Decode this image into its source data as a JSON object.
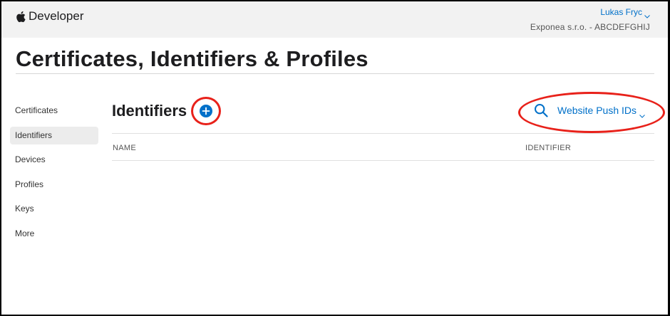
{
  "header": {
    "brand": "Developer",
    "user_name": "Lukas Fryc",
    "team": "Exponea s.r.o. - ABCDEFGHIJ"
  },
  "page": {
    "title": "Certificates, Identifiers & Profiles"
  },
  "sidebar": {
    "items": [
      {
        "label": "Certificates",
        "active": false
      },
      {
        "label": "Identifiers",
        "active": true
      },
      {
        "label": "Devices",
        "active": false
      },
      {
        "label": "Profiles",
        "active": false
      },
      {
        "label": "Keys",
        "active": false
      },
      {
        "label": "More",
        "active": false
      }
    ]
  },
  "section": {
    "title": "Identifiers",
    "filter_label": "Website Push IDs"
  },
  "table": {
    "columns": [
      "NAME",
      "IDENTIFIER"
    ],
    "rows": []
  },
  "colors": {
    "accent": "#0070c9",
    "highlight": "#e8211a",
    "active_bg": "#ececec"
  },
  "icons": {
    "brand": "apple-logo-icon",
    "add": "plus-circle-icon",
    "filter": "search-icon",
    "dropdown": "chevron-down-icon"
  }
}
